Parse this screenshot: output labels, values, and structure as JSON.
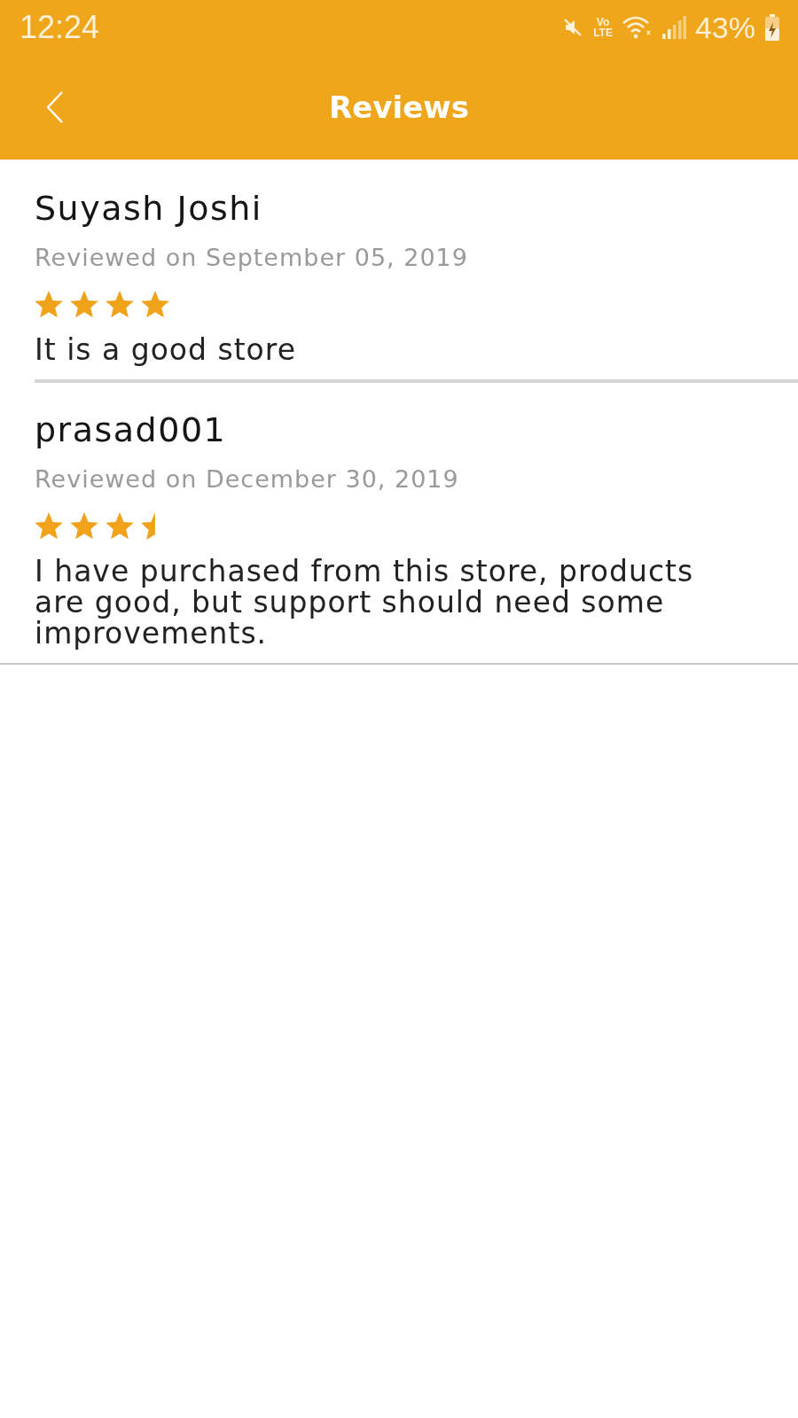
{
  "status_bar": {
    "time": "12:24",
    "volte": {
      "top": "Vo",
      "bottom": "LTE"
    },
    "battery": "43%"
  },
  "header": {
    "title": "Reviews"
  },
  "reviews": [
    {
      "name": "Suyash Joshi",
      "date": "Reviewed on September 05, 2019",
      "rating": [
        {
          "kind": "full"
        },
        {
          "kind": "full"
        },
        {
          "kind": "full"
        },
        {
          "kind": "full"
        }
      ],
      "text": "It is a good store"
    },
    {
      "name": "prasad001",
      "date": "Reviewed on December 30, 2019",
      "rating": [
        {
          "kind": "full"
        },
        {
          "kind": "full"
        },
        {
          "kind": "full"
        },
        {
          "kind": "half"
        }
      ],
      "text": "I have purchased from this store, products are good, but support should need some improvements."
    }
  ]
}
